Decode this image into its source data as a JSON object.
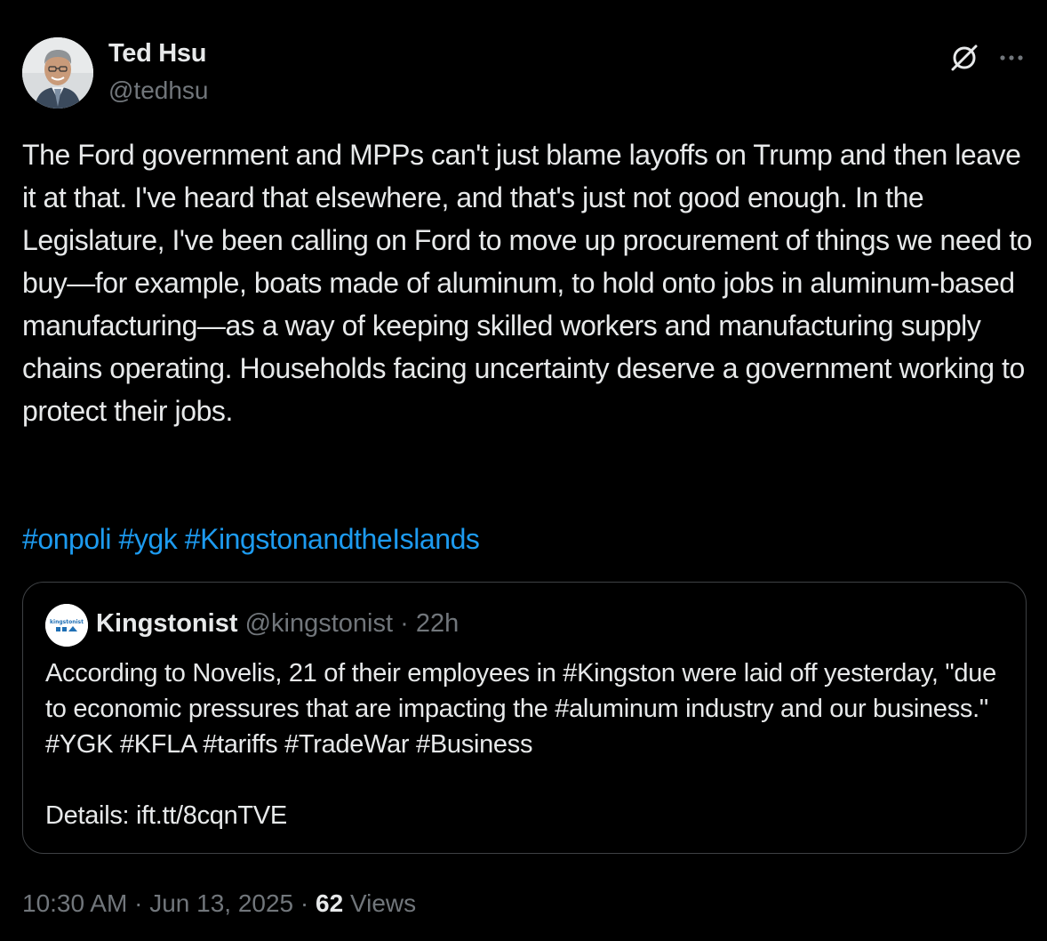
{
  "author": {
    "name": "Ted Hsu",
    "handle": "@tedhsu"
  },
  "tweet": {
    "text": "The Ford government and MPPs can't just blame layoffs on Trump and then leave it at that. I've heard that elsewhere, and that's just not good enough. In the Legislature, I've been calling on Ford to move up procurement of things we need to buy—for example, boats made of aluminum, to hold onto jobs in aluminum-based manufacturing—as a way of keeping skilled workers and manufacturing supply chains operating. Households facing uncertainty deserve a government working to protect their jobs.",
    "hashtags": [
      "#onpoli",
      "#ygk",
      "#KingstonandtheIslands"
    ]
  },
  "quote": {
    "name": "Kingstonist",
    "handle": "@kingstonist",
    "separator": "·",
    "time": "22h",
    "avatar_text": "kingstonist",
    "text": "According to Novelis, 21 of their employees in #Kingston were laid off yesterday, \"due to economic pressures that are impacting the #aluminum industry and our business.\" #YGK #KFLA #tariffs #TradeWar #Business\n\nDetails: ift.tt/8cqnTVE"
  },
  "meta": {
    "time": "10:30 AM",
    "separator": "·",
    "date": "Jun 13, 2025",
    "views_count": "62",
    "views_label": "Views"
  },
  "icons": {
    "grok": "grok-icon",
    "more": "more-dots-icon"
  },
  "colors": {
    "background": "#000000",
    "text": "#e7e9ea",
    "secondary": "#71767b",
    "link": "#1d9bf0",
    "border": "#3e4144"
  }
}
